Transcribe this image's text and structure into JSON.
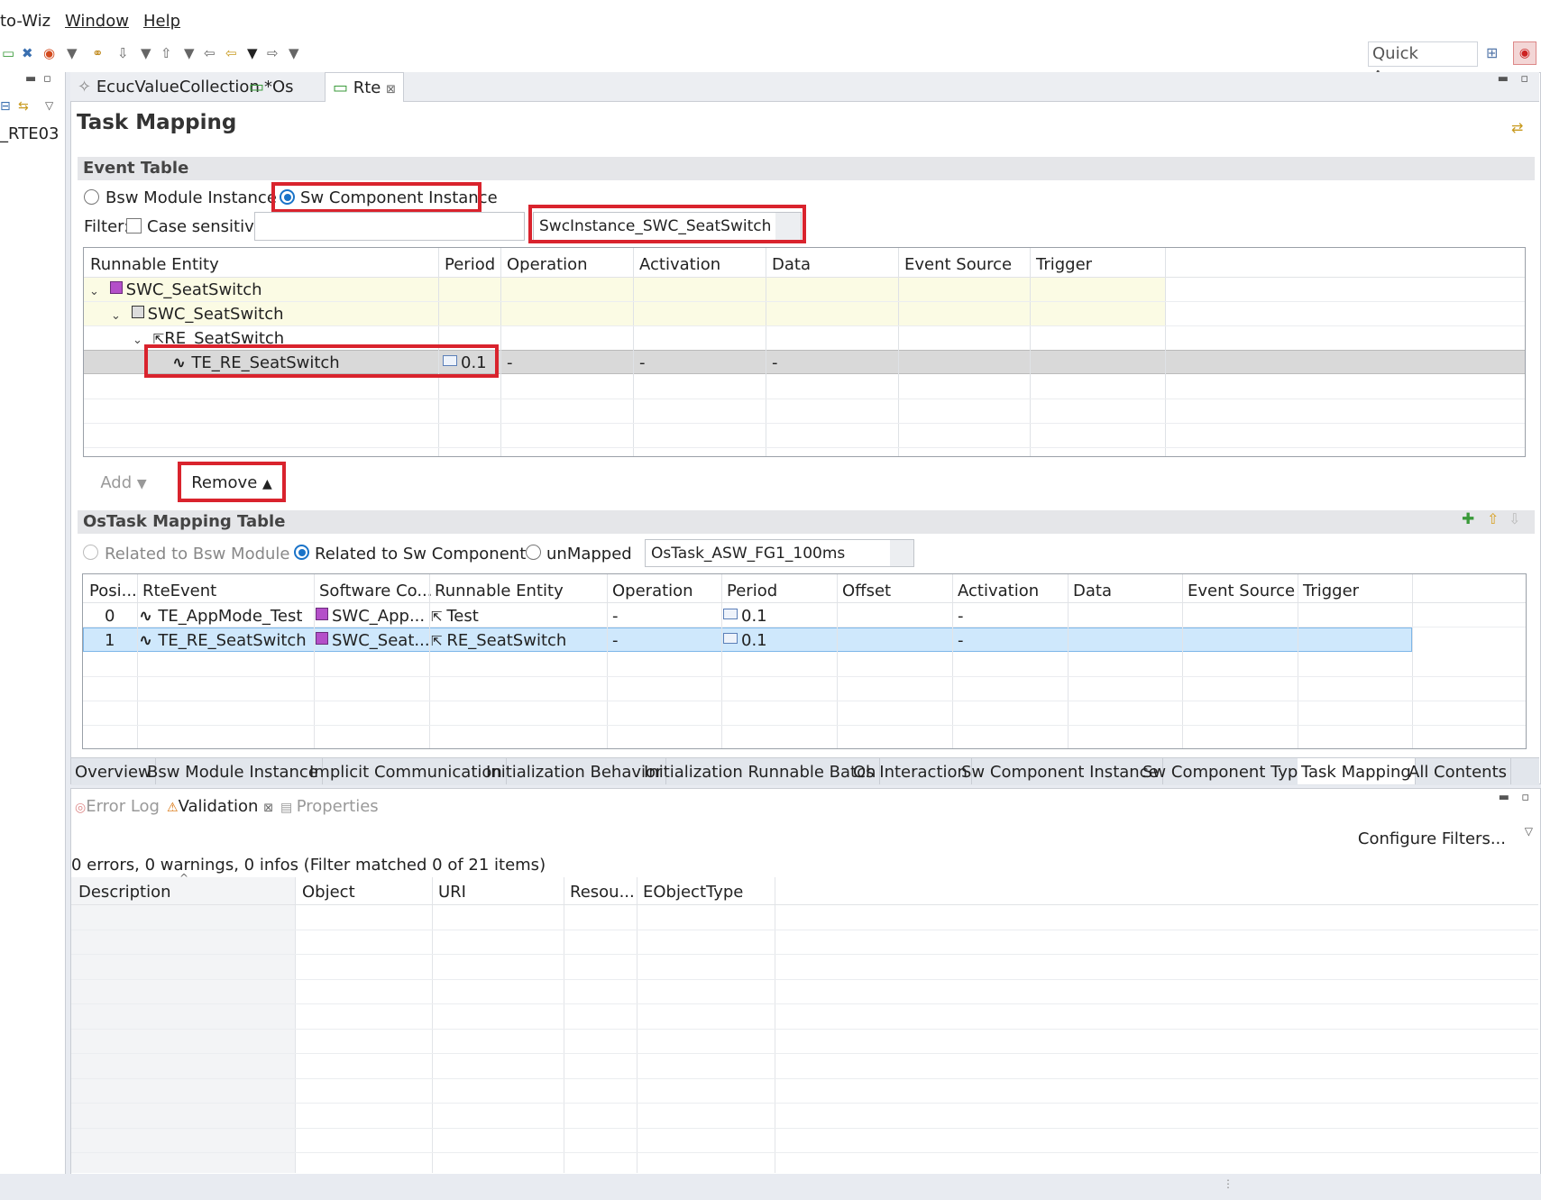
{
  "menu": {
    "items": [
      "to-Wiz",
      "Window",
      "Help"
    ]
  },
  "toolbar": {
    "quick_access": "Quick Access"
  },
  "left_pane": {
    "item": "_RTE03"
  },
  "editor_tabs": [
    {
      "label": "EcucValueCollection"
    },
    {
      "label": "*Os"
    },
    {
      "label": "Rte",
      "close": "⊠"
    }
  ],
  "page_title": "Task Mapping",
  "event_table": {
    "header": "Event Table",
    "radio_bsw": "Bsw Module Instance",
    "radio_swc": "Sw Component Instance",
    "filter_label": "Filter:",
    "case_sensitive": "Case sensitive",
    "filter_value": "",
    "instance_combo": "SwcInstance_SWC_SeatSwitch",
    "columns": [
      "Runnable Entity",
      "Period",
      "Operation",
      "Activation",
      "Data",
      "Event Source",
      "Trigger"
    ],
    "rows": [
      {
        "label": "SWC_SeatSwitch",
        "period": "",
        "operation": "",
        "activation": "",
        "data": ""
      },
      {
        "label": "SWC_SeatSwitch",
        "period": "",
        "operation": "",
        "activation": "",
        "data": ""
      },
      {
        "label": "RE_SeatSwitch",
        "period": "",
        "operation": "",
        "activation": "",
        "data": ""
      },
      {
        "label": "TE_RE_SeatSwitch",
        "period": "0.1",
        "operation": "-",
        "activation": "-",
        "data": "-"
      }
    ],
    "add_button": "Add",
    "remove_button": "Remove"
  },
  "ostask_table": {
    "header": "OsTask Mapping Table",
    "radio_bsw": "Related to Bsw Module",
    "radio_swc": "Related to Sw Component",
    "radio_unmapped": "unMapped",
    "task_combo": "OsTask_ASW_FG1_100ms",
    "columns": [
      "Posi...",
      "RteEvent",
      "Software Co...",
      "Runnable Entity",
      "Operation",
      "Period",
      "Offset",
      "Activation",
      "Data",
      "Event Source",
      "Trigger"
    ],
    "rows": [
      {
        "pos": "0",
        "event": "TE_AppMode_Test",
        "swc": "SWC_App...",
        "runnable": "Test",
        "operation": "-",
        "period": "0.1",
        "activation": "-"
      },
      {
        "pos": "1",
        "event": "TE_RE_SeatSwitch",
        "swc": "SWC_Seat...",
        "runnable": "RE_SeatSwitch",
        "operation": "-",
        "period": "0.1",
        "activation": "-"
      }
    ]
  },
  "bottom_tabs": [
    "Overview",
    "Bsw Module Instance",
    "Implicit Communication",
    "Initialization Behavior",
    "Initialization Runnable Batch",
    "Os Interaction",
    "Sw Component Instance",
    "Sw Component Type",
    "Task Mapping",
    "All Contents"
  ],
  "views": {
    "tabs": [
      "Error Log",
      "Validation",
      "Properties"
    ],
    "configure": "Configure Filters...",
    "summary": "0 errors, 0 warnings, 0 infos (Filter matched 0 of 21 items)",
    "columns": [
      "Description",
      "Object",
      "URI",
      "Resou...",
      "EObjectType"
    ]
  }
}
